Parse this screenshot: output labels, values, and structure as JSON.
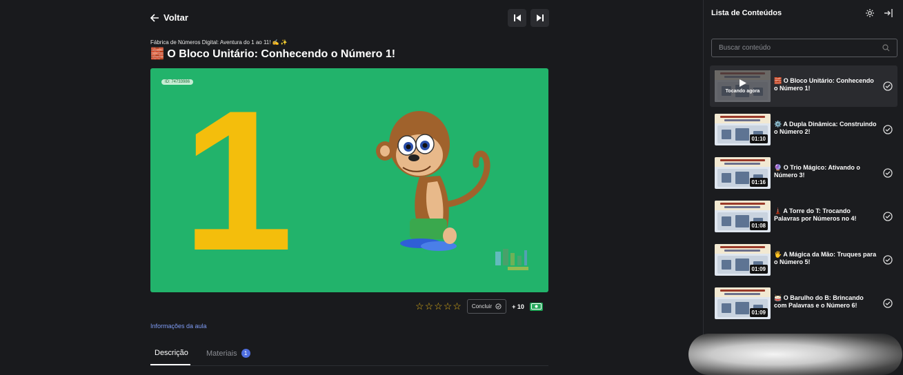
{
  "header": {
    "back_label": "Voltar"
  },
  "lesson": {
    "course_title": "Fábrica de Números Digital: Aventura do 1 ao 11! ✍️ ✨",
    "title": "🧱 O Bloco Unitário: Conhecendo o Número 1!",
    "video_id_badge": "ID: 74733986",
    "video_big_number": "1",
    "rating_stars": [
      "☆",
      "☆",
      "☆",
      "☆",
      "☆"
    ],
    "conclude_label": "Concluir",
    "points": "+ 10",
    "info_link": "Informações da aula"
  },
  "tabs": [
    {
      "label": "Descrição",
      "active": true
    },
    {
      "label": "Materiais",
      "count": "1"
    }
  ],
  "sidebar": {
    "title": "Lista de Conteúdos",
    "search_placeholder": "Buscar conteúdo",
    "items": [
      {
        "title": "🧱 O Bloco Unitário: Conhecendo o Número 1!",
        "status": "Tocando agora",
        "playing": true
      },
      {
        "title": "⚙️ A Dupla Dinâmica: Construindo o Número 2!",
        "duration": "01:10"
      },
      {
        "title": "🔮 O Trio Mágico: Ativando o Número 3!",
        "duration": "01:16"
      },
      {
        "title": "🗼 A Torre do T: Trocando Palavras por Números no 4!",
        "duration": "01:08"
      },
      {
        "title": "🖐️ A Mágica da Mão: Truques para o Número 5!",
        "duration": "01:09"
      },
      {
        "title": "🥁 O Barulho do B: Brincando com Palavras e o Número 6!",
        "duration": "01:09"
      }
    ]
  },
  "colors": {
    "background": "#191a1d",
    "video_green": "#22b36b",
    "number_yellow": "#f4be0c",
    "link_blue": "#7f9cf5",
    "star_gold": "#e0b11a"
  },
  "icons": {
    "back": "arrow-left-icon",
    "prev": "skip-previous-icon",
    "next": "skip-next-icon",
    "settings": "gear-icon",
    "collapse": "exit-panel-icon",
    "search": "search-icon",
    "check": "check-circle-icon",
    "play": "play-icon",
    "money": "money-icon"
  }
}
